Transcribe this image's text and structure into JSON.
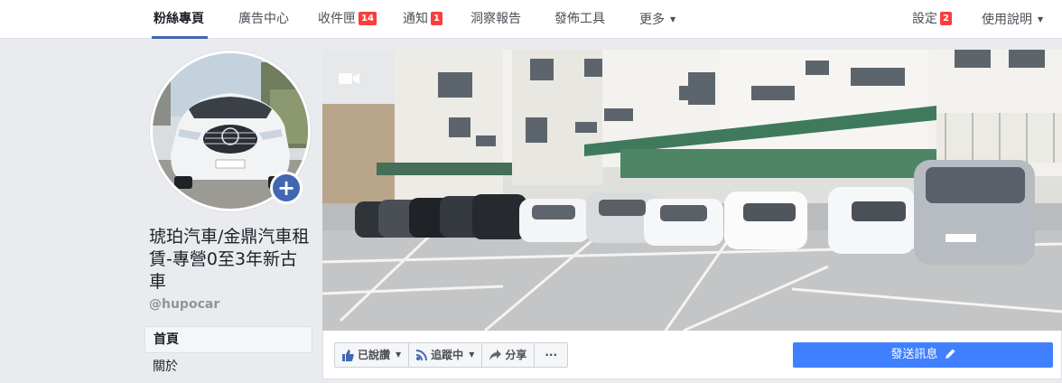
{
  "nav": {
    "items": [
      {
        "label": "粉絲專頁",
        "active": true
      },
      {
        "label": "廣告中心"
      },
      {
        "label": "收件匣",
        "badge": "14"
      },
      {
        "label": "通知",
        "badge": "1"
      },
      {
        "label": "洞察報告"
      },
      {
        "label": "發佈工具"
      },
      {
        "label": "更多"
      }
    ],
    "settings": {
      "label": "設定",
      "badge": "2"
    },
    "help": {
      "label": "使用說明"
    }
  },
  "page": {
    "title": "琥珀汽車/金鼎汽車租賃-專營0至3年新古車",
    "handle": "@hupocar"
  },
  "left_nav": [
    {
      "label": "首頁"
    },
    {
      "label": "關於"
    }
  ],
  "actions": {
    "liked": "已說讚",
    "following": "追蹤中",
    "share": "分享",
    "more": "···",
    "send_message": "發送訊息"
  },
  "colors": {
    "brand_blue": "#4267b2",
    "send_blue": "#4080ff",
    "badge_red": "#fa3e3e"
  },
  "icons": [
    "plus-icon",
    "video-camera-icon",
    "thumbs-up-icon",
    "rss-icon",
    "share-arrow-icon",
    "pencil-icon",
    "caret-down-icon"
  ]
}
